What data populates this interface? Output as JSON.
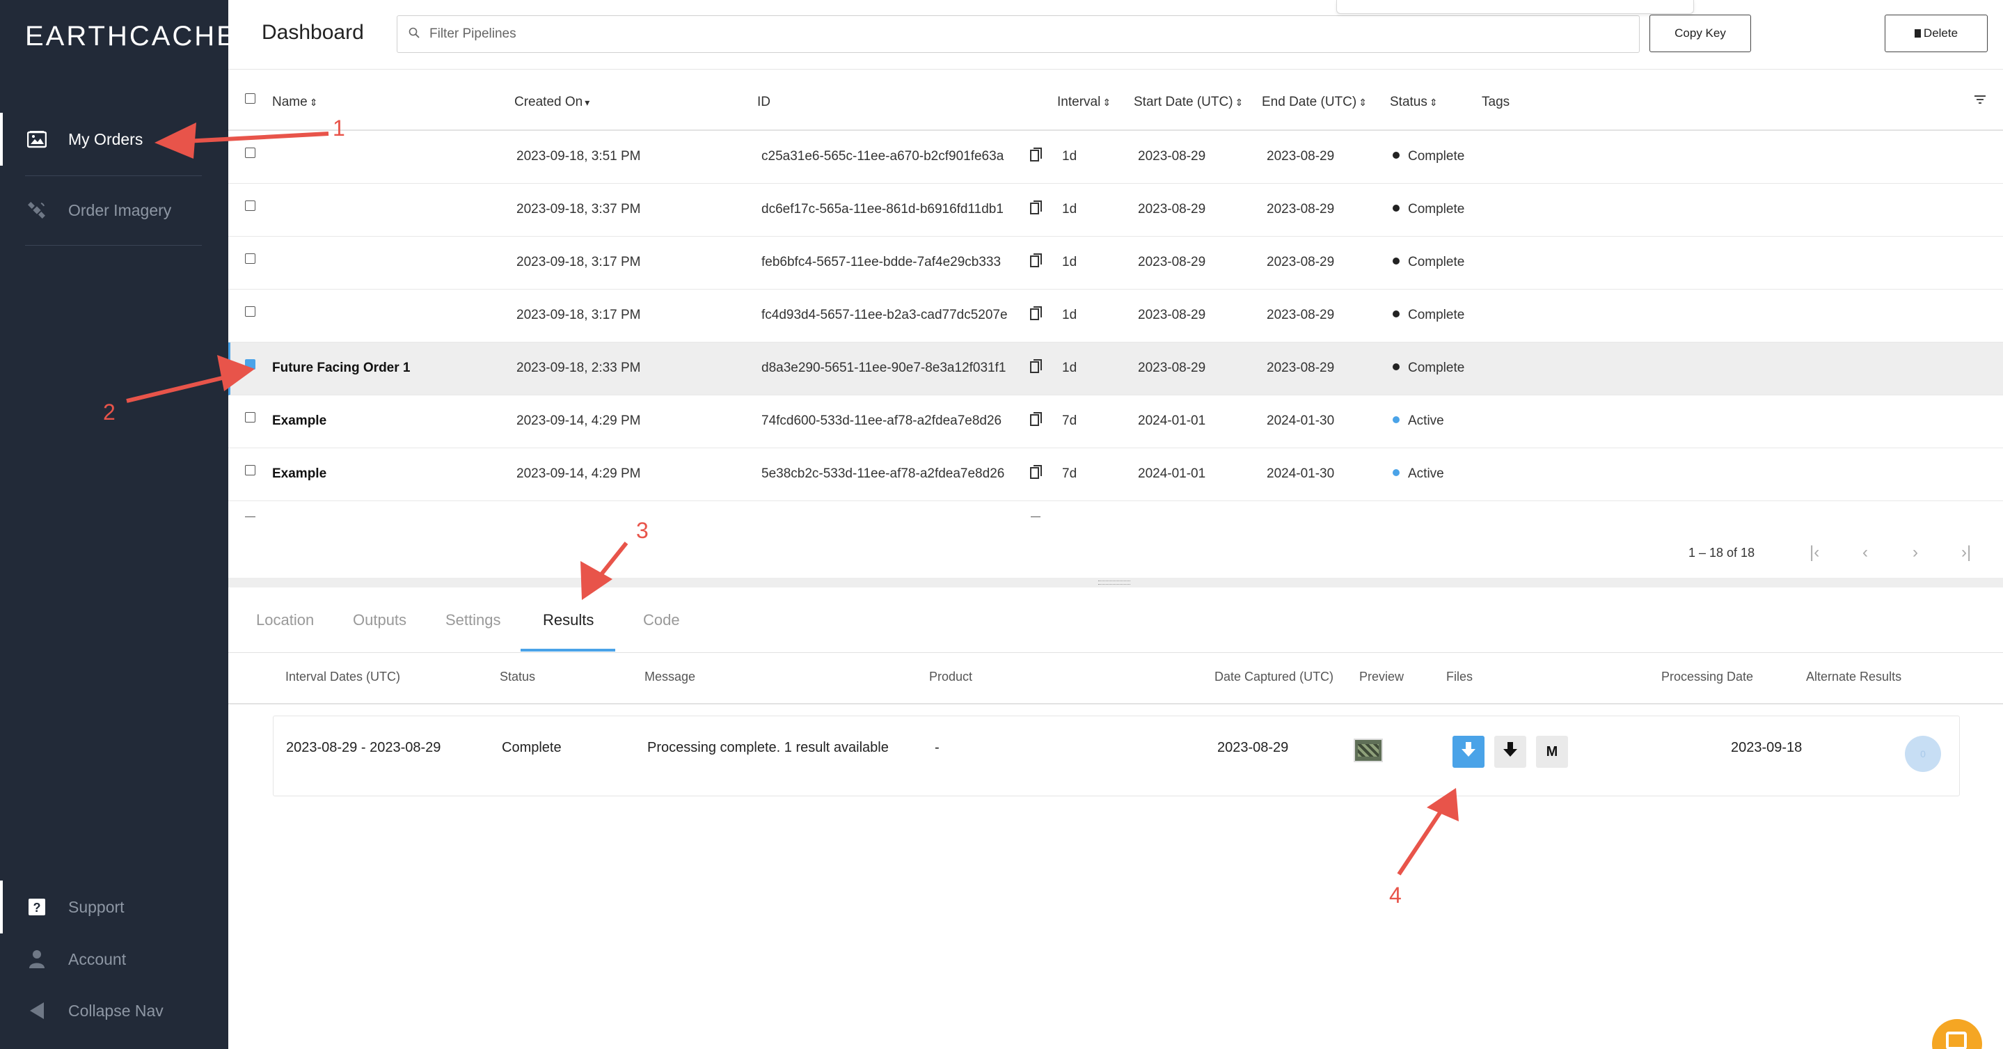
{
  "app": {
    "logo_text": "EARTHCACHE"
  },
  "sidebar": {
    "items": [
      {
        "label": "My Orders",
        "icon": "image-icon",
        "active": true
      },
      {
        "label": "Order Imagery",
        "icon": "satellite-icon",
        "active": false
      }
    ],
    "bottom_items": [
      {
        "label": "Support",
        "icon": "help-icon"
      },
      {
        "label": "Account",
        "icon": "person-icon"
      },
      {
        "label": "Collapse Nav",
        "icon": "triangle-left-icon"
      }
    ]
  },
  "header": {
    "title": "Dashboard",
    "filter_placeholder": "Filter Pipelines",
    "copy_key_label": "Copy Key",
    "delete_label": "Delete"
  },
  "table": {
    "columns": {
      "name": "Name",
      "created_on": "Created On",
      "id": "ID",
      "interval": "Interval",
      "start_date": "Start Date (UTC)",
      "end_date": "End Date (UTC)",
      "status": "Status",
      "tags": "Tags"
    },
    "rows": [
      {
        "name": "",
        "created_on": "2023-09-18, 3:51 PM",
        "id": "c25a31e6-565c-11ee-a670-b2cf901fe63a",
        "interval": "1d",
        "start_date": "2023-08-29",
        "end_date": "2023-08-29",
        "status": "Complete",
        "status_color": "#222222",
        "selected": false
      },
      {
        "name": "",
        "created_on": "2023-09-18, 3:37 PM",
        "id": "dc6ef17c-565a-11ee-861d-b6916fd11db1",
        "interval": "1d",
        "start_date": "2023-08-29",
        "end_date": "2023-08-29",
        "status": "Complete",
        "status_color": "#222222",
        "selected": false
      },
      {
        "name": "",
        "created_on": "2023-09-18, 3:17 PM",
        "id": "feb6bfc4-5657-11ee-bdde-7af4e29cb333",
        "interval": "1d",
        "start_date": "2023-08-29",
        "end_date": "2023-08-29",
        "status": "Complete",
        "status_color": "#222222",
        "selected": false
      },
      {
        "name": "",
        "created_on": "2023-09-18, 3:17 PM",
        "id": "fc4d93d4-5657-11ee-b2a3-cad77dc5207e",
        "interval": "1d",
        "start_date": "2023-08-29",
        "end_date": "2023-08-29",
        "status": "Complete",
        "status_color": "#222222",
        "selected": false
      },
      {
        "name": "Future Facing Order 1",
        "created_on": "2023-09-18, 2:33 PM",
        "id": "d8a3e290-5651-11ee-90e7-8e3a12f031f1",
        "interval": "1d",
        "start_date": "2023-08-29",
        "end_date": "2023-08-29",
        "status": "Complete",
        "status_color": "#222222",
        "selected": true
      },
      {
        "name": "Example",
        "created_on": "2023-09-14, 4:29 PM",
        "id": "74fcd600-533d-11ee-af78-a2fdea7e8d26",
        "interval": "7d",
        "start_date": "2024-01-01",
        "end_date": "2024-01-30",
        "status": "Active",
        "status_color": "#4aa3e8",
        "selected": false
      },
      {
        "name": "Example",
        "created_on": "2023-09-14, 4:29 PM",
        "id": "5e38cb2c-533d-11ee-af78-a2fdea7e8d26",
        "interval": "7d",
        "start_date": "2024-01-01",
        "end_date": "2024-01-30",
        "status": "Active",
        "status_color": "#4aa3e8",
        "selected": false
      }
    ],
    "pagination": {
      "range": "1 – 18 of 18"
    }
  },
  "detail": {
    "tabs": [
      "Location",
      "Outputs",
      "Settings",
      "Results",
      "Code"
    ],
    "active_tab": "Results",
    "results_columns": {
      "interval_dates": "Interval Dates (UTC)",
      "status": "Status",
      "message": "Message",
      "product": "Product",
      "date_captured": "Date Captured (UTC)",
      "preview": "Preview",
      "files": "Files",
      "processing_date": "Processing Date",
      "alternate_results": "Alternate Results"
    },
    "result": {
      "interval_dates": "2023-08-29 - 2023-08-29",
      "status": "Complete",
      "message": "Processing complete. 1 result available",
      "product": "-",
      "date_captured": "2023-08-29",
      "processing_date": "2023-09-18",
      "file_m_label": "M",
      "alternate_count": "0"
    }
  },
  "annotations": {
    "one": "1",
    "two": "2",
    "three": "3",
    "four": "4",
    "color": "#e8544a"
  },
  "colors": {
    "sidebar_bg": "#222a38",
    "accent": "#4aa3e8",
    "annotation": "#e8544a"
  }
}
